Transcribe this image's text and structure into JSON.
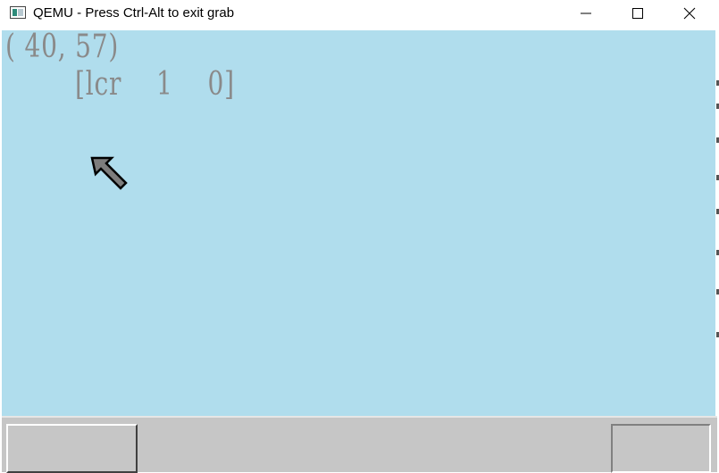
{
  "window": {
    "title": "QEMU - Press Ctrl-Alt to exit grab"
  },
  "titlebar_buttons": {
    "minimize_icon": "minimize-icon",
    "maximize_icon": "maximize-icon",
    "close_icon": "close-icon"
  },
  "screen": {
    "background": "#b0dded",
    "coords_text": "( 40, 57)",
    "mouse_info_text": "[lcr    1    0]",
    "cursor_icon": "arrow-cursor-icon"
  },
  "taskbar": {
    "background": "#c6c6c6"
  }
}
